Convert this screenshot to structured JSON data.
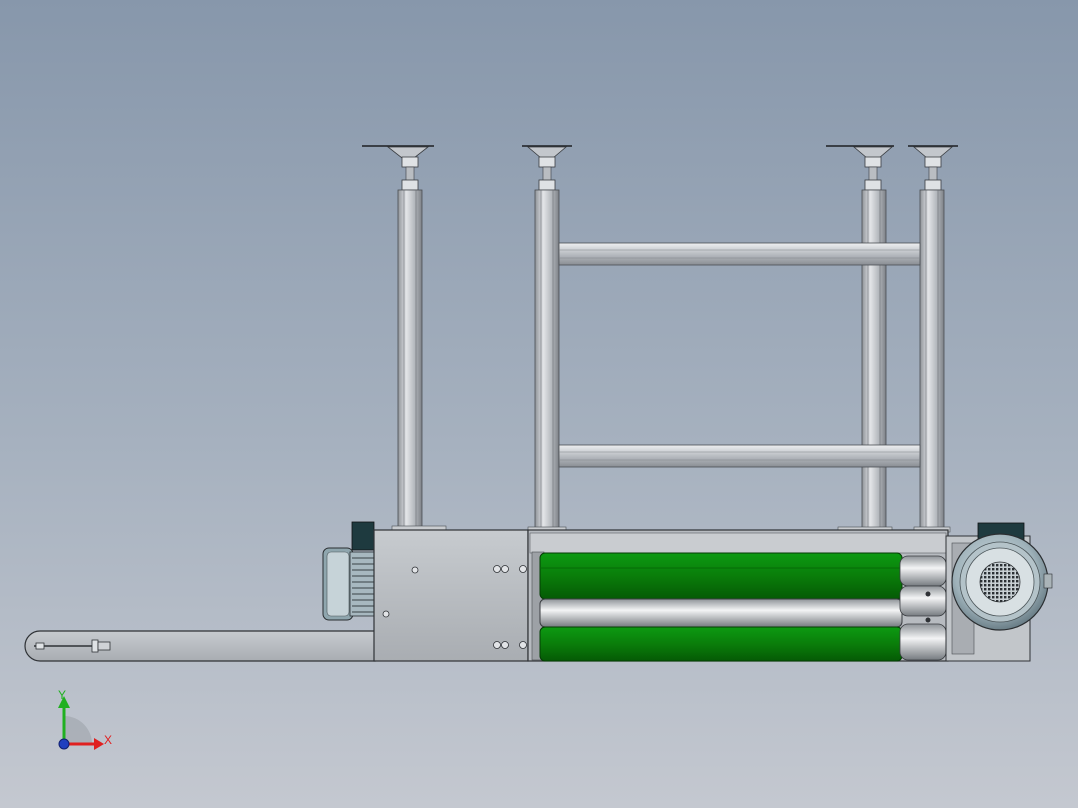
{
  "viewport": {
    "background_top": "#8797ab",
    "background_bottom": "#c4c8d0"
  },
  "model": {
    "frame_color": "#b9bdc2",
    "belt_color": "#0a7d0a",
    "roller_color": "#c9cdd1",
    "motor_color": "#a7b8c0",
    "foot_count": 4,
    "roller_count": 3
  },
  "triad": {
    "x_label": "X",
    "y_label": "Y",
    "x_color": "#e02020",
    "y_color": "#20b020",
    "z_color": "#1f3fbf"
  }
}
